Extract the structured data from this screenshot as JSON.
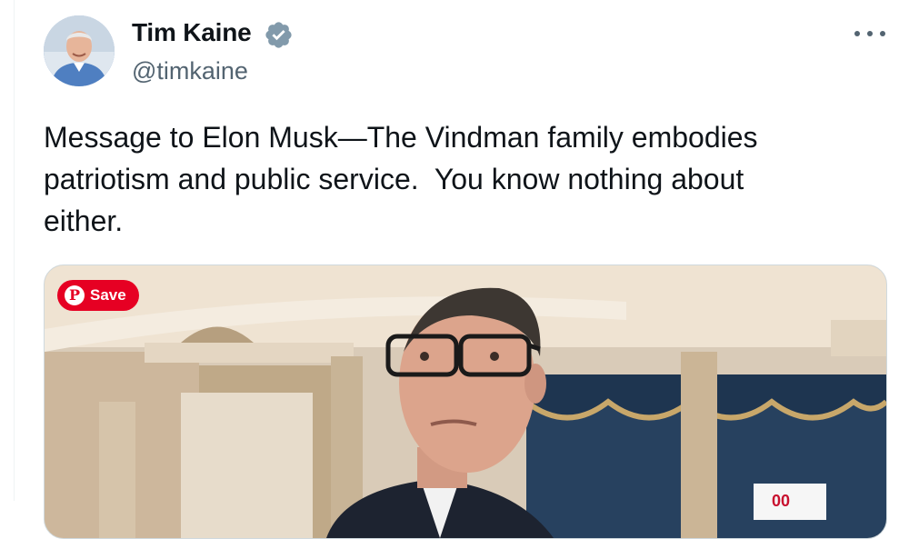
{
  "author": {
    "display_name": "Tim Kaine",
    "handle": "@timkaine",
    "verified_icon": "verified-badge-icon",
    "avatar_icon": "avatar"
  },
  "more_menu": {
    "icon": "more-horizontal-icon"
  },
  "tweet": {
    "text": "Message to Elon Musk—The Vindman family embodies\npatriotism and public service.  You know nothing about\neither."
  },
  "media": {
    "save_button": {
      "label": "Save",
      "icon": "pinterest-icon",
      "color": "#e60023"
    }
  },
  "colors": {
    "text_primary": "#0f1419",
    "text_secondary": "#536471",
    "verified_badge": "#829aab"
  }
}
